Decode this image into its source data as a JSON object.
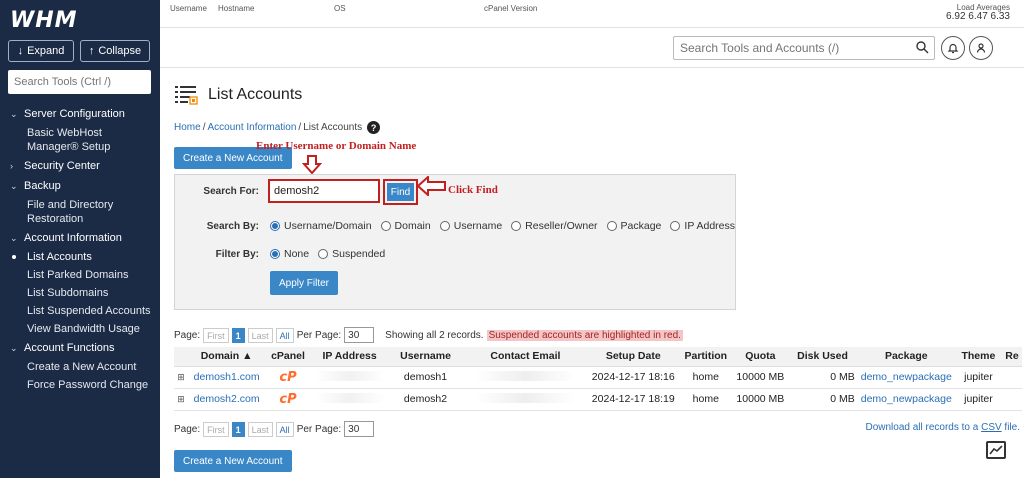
{
  "sidebar": {
    "logo": "WHM",
    "expand_label": "Expand",
    "collapse_label": "Collapse",
    "search_placeholder": "Search Tools (Ctrl /)",
    "nav": [
      {
        "type": "section",
        "label": "Server Configuration",
        "open": true
      },
      {
        "type": "item",
        "label": "Basic WebHost Manager® Setup"
      },
      {
        "type": "section",
        "label": "Security Center",
        "open": false
      },
      {
        "type": "section",
        "label": "Backup",
        "open": true
      },
      {
        "type": "item",
        "label": "File and Directory Restoration"
      },
      {
        "type": "section",
        "label": "Account Information",
        "open": true
      },
      {
        "type": "item",
        "label": "List Accounts",
        "active": true
      },
      {
        "type": "item",
        "label": "List Parked Domains"
      },
      {
        "type": "item",
        "label": "List Subdomains"
      },
      {
        "type": "item",
        "label": "List Suspended Accounts"
      },
      {
        "type": "item",
        "label": "View Bandwidth Usage"
      },
      {
        "type": "section",
        "label": "Account Functions",
        "open": true
      },
      {
        "type": "item",
        "label": "Create a New Account"
      },
      {
        "type": "item",
        "label": "Force Password Change"
      }
    ]
  },
  "topbar": {
    "username_label": "Username",
    "hostname_label": "Hostname",
    "os_label": "OS",
    "cpanel_version_label": "cPanel Version",
    "load_label": "Load Averages",
    "load_values": "6.92  6.47  6.33"
  },
  "header": {
    "search_placeholder": "Search Tools and Accounts (/)"
  },
  "page": {
    "title": "List Accounts",
    "breadcrumb": [
      "Home",
      "Account Information",
      "List Accounts"
    ],
    "create_button": "Create a New Account"
  },
  "annotations": {
    "enter": "Enter Username or Domain Name",
    "find": "Click Find"
  },
  "search": {
    "search_for_label": "Search For:",
    "search_value": "demosh2",
    "find_label": "Find",
    "search_by_label": "Search By:",
    "search_by_options": [
      "Username/Domain",
      "Domain",
      "Username",
      "Reseller/Owner",
      "Package",
      "IP Address"
    ],
    "search_by_selected": 0,
    "filter_by_label": "Filter By:",
    "filter_options": [
      "None",
      "Suspended"
    ],
    "filter_selected": 0,
    "apply_label": "Apply Filter"
  },
  "pager": {
    "page_label": "Page:",
    "first": "First",
    "current": "1",
    "last": "Last",
    "all": "All",
    "per_page_label": "Per Page:",
    "per_page_value": "30",
    "showing_text": "Showing all 2 records.",
    "suspended_note": "Suspended accounts are highlighted in red.",
    "csv_prefix": "Download all records to a ",
    "csv_link": "CSV",
    "csv_suffix": " file."
  },
  "table": {
    "columns": [
      "",
      "Domain ▲",
      "cPanel",
      "IP Address",
      "Username",
      "Contact Email",
      "Setup Date",
      "Partition",
      "Quota",
      "Disk Used",
      "Package",
      "Theme",
      "Re"
    ],
    "rows": [
      {
        "domain": "demosh1.com",
        "cpanel": "cP",
        "username": "demosh1",
        "setup_date": "2024-12-17 18:16",
        "partition": "home",
        "quota": "10000 MB",
        "disk_used": "0 MB",
        "package": "demo_newpackage",
        "theme": "jupiter"
      },
      {
        "domain": "demosh2.com",
        "cpanel": "cP",
        "username": "demosh2",
        "setup_date": "2024-12-17 18:19",
        "partition": "home",
        "quota": "10000 MB",
        "disk_used": "0 MB",
        "package": "demo_newpackage",
        "theme": "jupiter"
      }
    ]
  },
  "colors": {
    "sidebar_bg": "#1b2a45",
    "accent": "#3a87c8",
    "annotation_red": "#c21f1f",
    "cpanel_orange": "#ff6c2c"
  }
}
